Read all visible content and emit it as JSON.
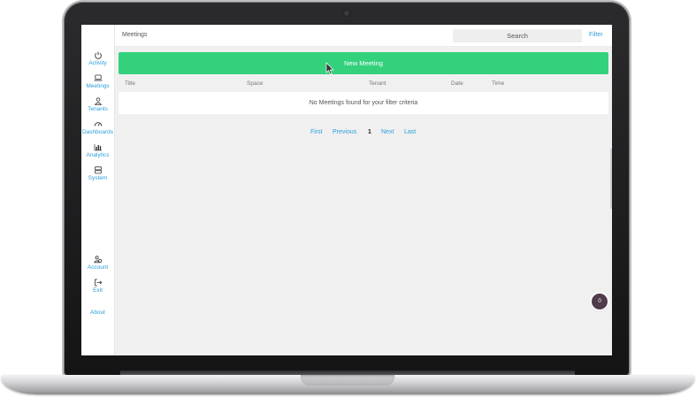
{
  "app": {
    "page_title": "Meetings"
  },
  "sidebar": {
    "items": [
      {
        "label": "Activity",
        "icon": "power-icon"
      },
      {
        "label": "Meetings",
        "icon": "laptop-icon"
      },
      {
        "label": "Tenants",
        "icon": "user-icon"
      },
      {
        "label": "Dashboards",
        "icon": "gauge-icon"
      },
      {
        "label": "Analytics",
        "icon": "bar-chart-icon"
      },
      {
        "label": "System",
        "icon": "server-icon"
      }
    ],
    "bottom_items": [
      {
        "label": "Account",
        "icon": "users-icon"
      },
      {
        "label": "Exit",
        "icon": "exit-icon"
      },
      {
        "label": "About",
        "icon": ""
      }
    ]
  },
  "topbar": {
    "search_placeholder": "Search",
    "filter_label": "Filter"
  },
  "main": {
    "new_button_label": "New Meeting",
    "columns": [
      "Title",
      "Space",
      "Tenant",
      "Date",
      "Time"
    ],
    "empty_message": "No Meetings found for your filter criteria"
  },
  "pagination": {
    "first": "First",
    "previous": "Previous",
    "current": "1",
    "next": "Next",
    "last": "Last"
  },
  "badge": {
    "count": "0"
  },
  "colors": {
    "accent_link": "#2b9fd9",
    "primary_button": "#34d17d",
    "badge_bg": "#4f3b4b",
    "screen_bg": "#f0f0f0"
  }
}
